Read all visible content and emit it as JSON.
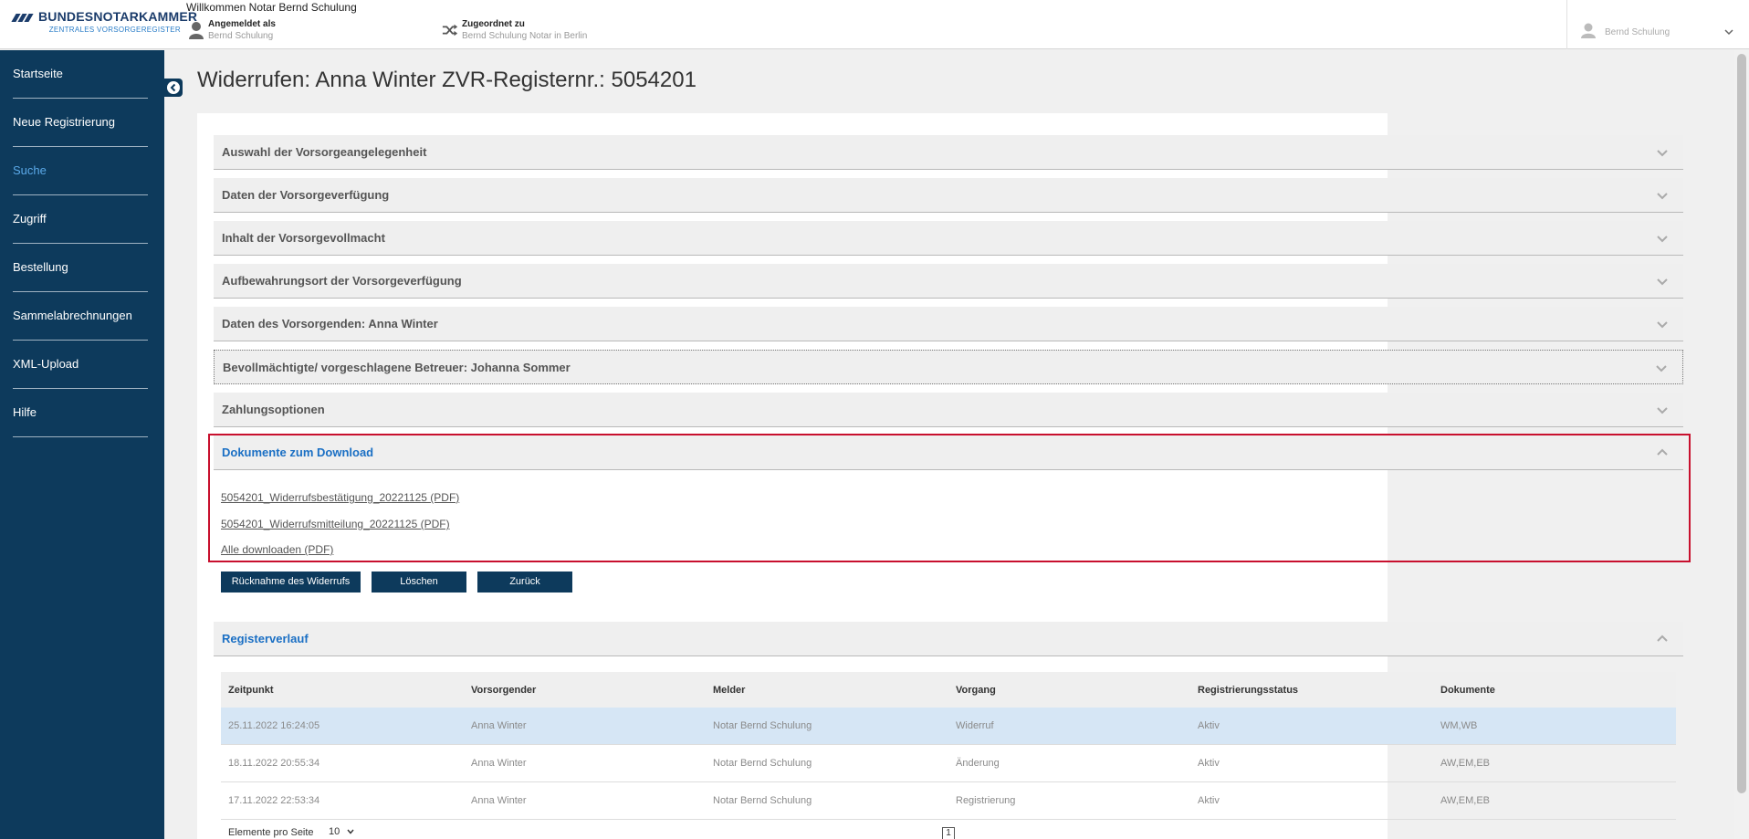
{
  "header": {
    "brand": "BUNDESNOTARKAMMER",
    "brand_sub": "ZENTRALES VORSORGEREGISTER",
    "welcome": "Willkommen Notar Bernd Schulung",
    "logged_in_label": "Angemeldet als",
    "logged_in_value": "Bernd Schulung",
    "assigned_label": "Zugeordnet zu",
    "assigned_value": "Bernd Schulung Notar in Berlin",
    "user_name": "Bernd Schulung"
  },
  "sidebar": {
    "items": [
      {
        "label": "Startseite"
      },
      {
        "label": "Neue Registrierung"
      },
      {
        "label": "Suche"
      },
      {
        "label": "Zugriff"
      },
      {
        "label": "Bestellung"
      },
      {
        "label": "Sammelabrechnungen"
      },
      {
        "label": "XML-Upload"
      },
      {
        "label": "Hilfe"
      }
    ],
    "active_index": 2
  },
  "page": {
    "title": "Widerrufen: Anna Winter ZVR-Registernr.: 5054201"
  },
  "accordion": {
    "sections": [
      {
        "label": "Auswahl der Vorsorgeangelegenheit"
      },
      {
        "label": "Daten der Vorsorgeverfügung"
      },
      {
        "label": "Inhalt der Vorsorgevollmacht"
      },
      {
        "label": "Aufbewahrungsort der Vorsorgeverfügung"
      },
      {
        "label": "Daten des Vorsorgenden: Anna Winter"
      },
      {
        "label": "Bevollmächtigte/ vorgeschlagene Betreuer: Johanna Sommer"
      },
      {
        "label": "Zahlungsoptionen"
      },
      {
        "label": "Dokumente zum Download"
      }
    ],
    "register_label": "Registerverlauf"
  },
  "documents": {
    "links": [
      {
        "label": "5054201_Widerrufsbestätigung_20221125 (PDF)"
      },
      {
        "label": "5054201_Widerrufsmitteilung_20221125 (PDF)"
      },
      {
        "label": "Alle downloaden (PDF)"
      }
    ]
  },
  "actions": {
    "withdraw_label": "Rücknahme des Widerrufs",
    "delete_label": "Löschen",
    "back_label": "Zurück"
  },
  "table": {
    "headers": [
      "Zeitpunkt",
      "Vorsorgender",
      "Melder",
      "Vorgang",
      "Registrierungsstatus",
      "Dokumente"
    ],
    "rows": [
      [
        "25.11.2022 16:24:05",
        "Anna Winter",
        "Notar Bernd Schulung",
        "Widerruf",
        "Aktiv",
        "WM,WB"
      ],
      [
        "18.11.2022 20:55:34",
        "Anna Winter",
        "Notar Bernd Schulung",
        "Änderung",
        "Aktiv",
        "AW,EM,EB"
      ],
      [
        "17.11.2022 22:53:34",
        "Anna Winter",
        "Notar Bernd Schulung",
        "Registrierung",
        "Aktiv",
        "AW,EM,EB"
      ]
    ],
    "selected_row": 0
  },
  "pager": {
    "label": "Elemente pro Seite",
    "per_page": "10",
    "page": "1"
  },
  "colors": {
    "sidebar": "#0d3a5c",
    "accent": "#1a6fc4",
    "highlight_border": "#c8102e",
    "selected_row": "#d6e6f5"
  }
}
